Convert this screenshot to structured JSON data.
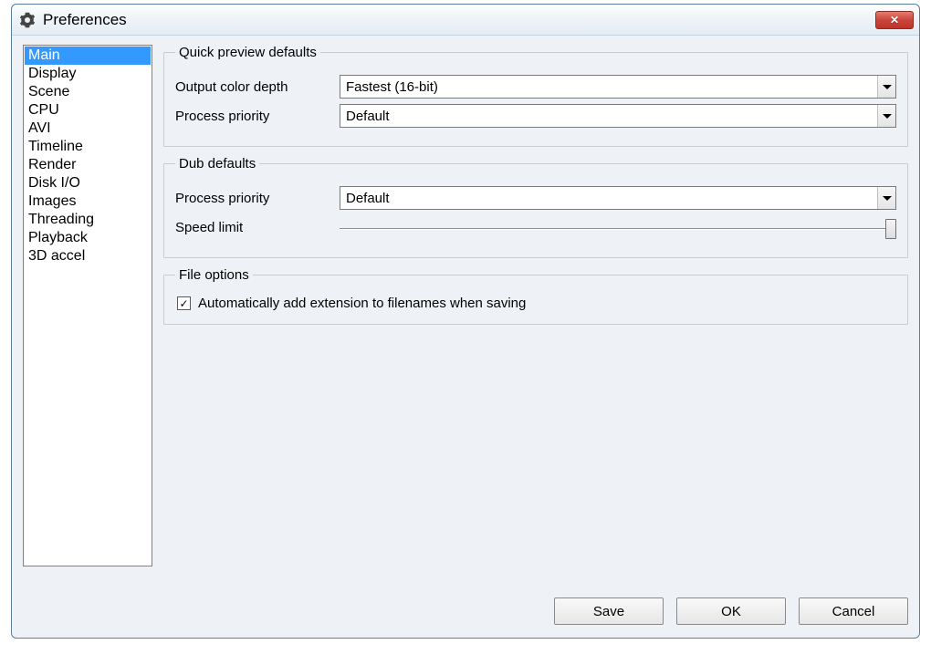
{
  "window": {
    "title": "Preferences"
  },
  "sidebar": {
    "items": [
      {
        "label": "Main",
        "selected": true
      },
      {
        "label": "Display",
        "selected": false
      },
      {
        "label": "Scene",
        "selected": false
      },
      {
        "label": "CPU",
        "selected": false
      },
      {
        "label": "AVI",
        "selected": false
      },
      {
        "label": "Timeline",
        "selected": false
      },
      {
        "label": "Render",
        "selected": false
      },
      {
        "label": "Disk I/O",
        "selected": false
      },
      {
        "label": "Images",
        "selected": false
      },
      {
        "label": "Threading",
        "selected": false
      },
      {
        "label": "Playback",
        "selected": false
      },
      {
        "label": "3D accel",
        "selected": false
      }
    ]
  },
  "groups": {
    "quick_preview": {
      "legend": "Quick preview defaults",
      "output_color_depth_label": "Output color depth",
      "output_color_depth_value": "Fastest (16-bit)",
      "process_priority_label": "Process priority",
      "process_priority_value": "Default"
    },
    "dub_defaults": {
      "legend": "Dub defaults",
      "process_priority_label": "Process priority",
      "process_priority_value": "Default",
      "speed_limit_label": "Speed limit",
      "speed_limit_position": 100
    },
    "file_options": {
      "legend": "File options",
      "auto_ext_checked": true,
      "auto_ext_label": "Automatically add extension to filenames when saving"
    }
  },
  "buttons": {
    "save": "Save",
    "ok": "OK",
    "cancel": "Cancel"
  }
}
